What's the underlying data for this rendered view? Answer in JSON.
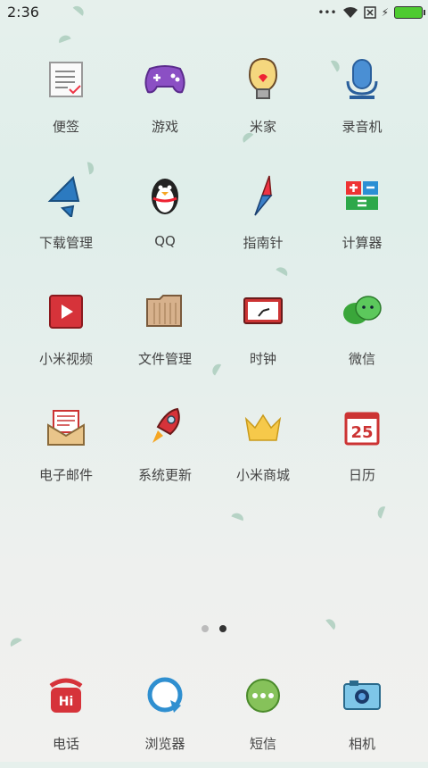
{
  "status_bar": {
    "time": "2:36"
  },
  "apps": [
    {
      "label": "便签",
      "icon": "notes-icon"
    },
    {
      "label": "游戏",
      "icon": "game-controller-icon"
    },
    {
      "label": "米家",
      "icon": "lightbulb-icon"
    },
    {
      "label": "录音机",
      "icon": "microphone-icon"
    },
    {
      "label": "下载管理",
      "icon": "download-arrow-icon"
    },
    {
      "label": "QQ",
      "icon": "penguin-icon"
    },
    {
      "label": "指南针",
      "icon": "compass-needle-icon"
    },
    {
      "label": "计算器",
      "icon": "calculator-icon"
    },
    {
      "label": "小米视频",
      "icon": "video-play-icon"
    },
    {
      "label": "文件管理",
      "icon": "folder-icon"
    },
    {
      "label": "时钟",
      "icon": "clock-icon"
    },
    {
      "label": "微信",
      "icon": "chat-bubbles-icon"
    },
    {
      "label": "电子邮件",
      "icon": "envelope-icon"
    },
    {
      "label": "系统更新",
      "icon": "rocket-icon"
    },
    {
      "label": "小米商城",
      "icon": "crown-icon"
    },
    {
      "label": "日历",
      "icon": "calendar-icon",
      "day": "25"
    }
  ],
  "dock": [
    {
      "label": "电话",
      "icon": "phone-icon",
      "badge": "Hi"
    },
    {
      "label": "浏览器",
      "icon": "browser-icon"
    },
    {
      "label": "短信",
      "icon": "message-icon"
    },
    {
      "label": "相机",
      "icon": "camera-icon"
    }
  ],
  "page_indicator": {
    "pages": 2,
    "current": 2
  }
}
